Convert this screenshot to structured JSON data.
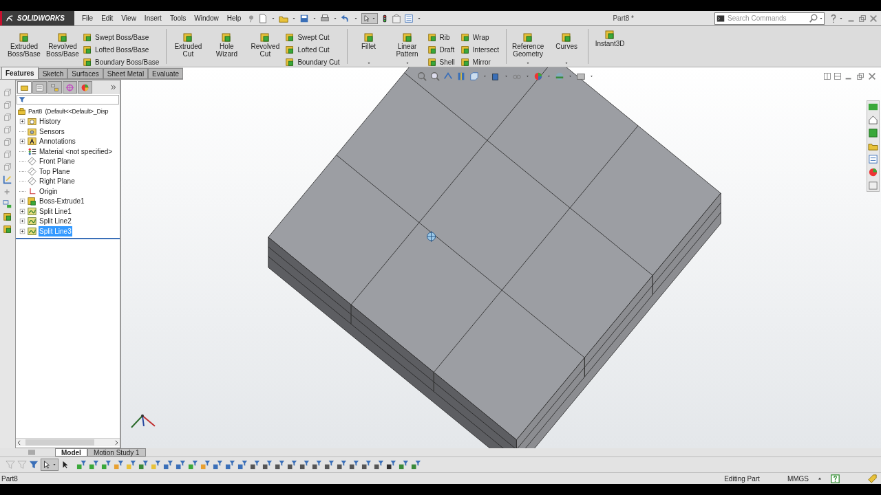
{
  "app": {
    "brand": "SOLIDWORKS",
    "title": "Part8 *"
  },
  "menu": [
    "File",
    "Edit",
    "View",
    "Insert",
    "Tools",
    "Window",
    "Help"
  ],
  "search": {
    "placeholder": "Search Commands"
  },
  "ribbon": [
    {
      "large": [
        {
          "label": "Extruded Boss/Base",
          "dropdown": false
        },
        {
          "label": "Revolved Boss/Base",
          "dropdown": false
        }
      ],
      "small": [
        [
          "Swept Boss/Base",
          "Lofted Boss/Base",
          "Boundary Boss/Base"
        ]
      ]
    },
    {
      "large": [
        {
          "label": "Extruded Cut",
          "dropdown": false
        },
        {
          "label": "Hole Wizard",
          "dropdown": false
        },
        {
          "label": "Revolved Cut",
          "dropdown": false
        }
      ],
      "small": [
        [
          "Swept Cut",
          "Lofted Cut",
          "Boundary Cut"
        ]
      ]
    },
    {
      "large": [
        {
          "label": "Fillet",
          "dropdown": true
        },
        {
          "label": "Linear Pattern",
          "dropdown": true
        }
      ],
      "small": [
        [
          "Rib",
          "Draft",
          "Shell"
        ],
        [
          "Wrap",
          "Intersect",
          "Mirror"
        ]
      ]
    },
    {
      "large": [
        {
          "label": "Reference Geometry",
          "dropdown": true
        },
        {
          "label": "Curves",
          "dropdown": true
        }
      ]
    },
    {
      "large": [
        {
          "label": "Instant3D",
          "dropdown": false
        }
      ]
    }
  ],
  "command_tabs": [
    {
      "label": "Features",
      "selected": true
    },
    {
      "label": "Sketch",
      "selected": false
    },
    {
      "label": "Surfaces",
      "selected": false
    },
    {
      "label": "Sheet Metal",
      "selected": false
    },
    {
      "label": "Evaluate",
      "selected": false
    }
  ],
  "manager_tabs": [
    {
      "kind": "tree",
      "selected": true
    },
    {
      "kind": "property",
      "selected": false
    },
    {
      "kind": "config",
      "selected": false
    },
    {
      "kind": "dimxpert",
      "selected": false
    },
    {
      "kind": "display",
      "selected": false
    }
  ],
  "tree": {
    "label": "Part8  (Default<<Default>_Disp",
    "kind": "part",
    "children": [
      {
        "label": "History",
        "kind": "history",
        "expanded": false,
        "selected": false
      },
      {
        "label": "Sensors",
        "kind": "sensors",
        "selected": false
      },
      {
        "label": "Annotations",
        "kind": "annotations",
        "expanded": false,
        "selected": false
      },
      {
        "label": "Material <not specified>",
        "kind": "material",
        "selected": false
      },
      {
        "label": "Front Plane",
        "kind": "plane",
        "selected": false
      },
      {
        "label": "Top Plane",
        "kind": "plane",
        "selected": false
      },
      {
        "label": "Right Plane",
        "kind": "plane",
        "selected": false
      },
      {
        "label": "Origin",
        "kind": "origin",
        "selected": false
      },
      {
        "label": "Boss-Extrude1",
        "kind": "extrude",
        "expanded": false,
        "selected": false
      },
      {
        "label": "Split Line1",
        "kind": "splitline",
        "expanded": false,
        "selected": false
      },
      {
        "label": "Split Line2",
        "kind": "splitline",
        "expanded": false,
        "selected": false
      },
      {
        "label": "Split Line3",
        "kind": "splitline",
        "expanded": false,
        "selected": true
      }
    ]
  },
  "bottom_tabs": [
    {
      "label": "Model",
      "selected": true
    },
    {
      "label": "Motion Study 1",
      "selected": false
    }
  ],
  "status_bar": {
    "document": "Part8",
    "mode": "Editing Part",
    "units": "MMGS"
  }
}
